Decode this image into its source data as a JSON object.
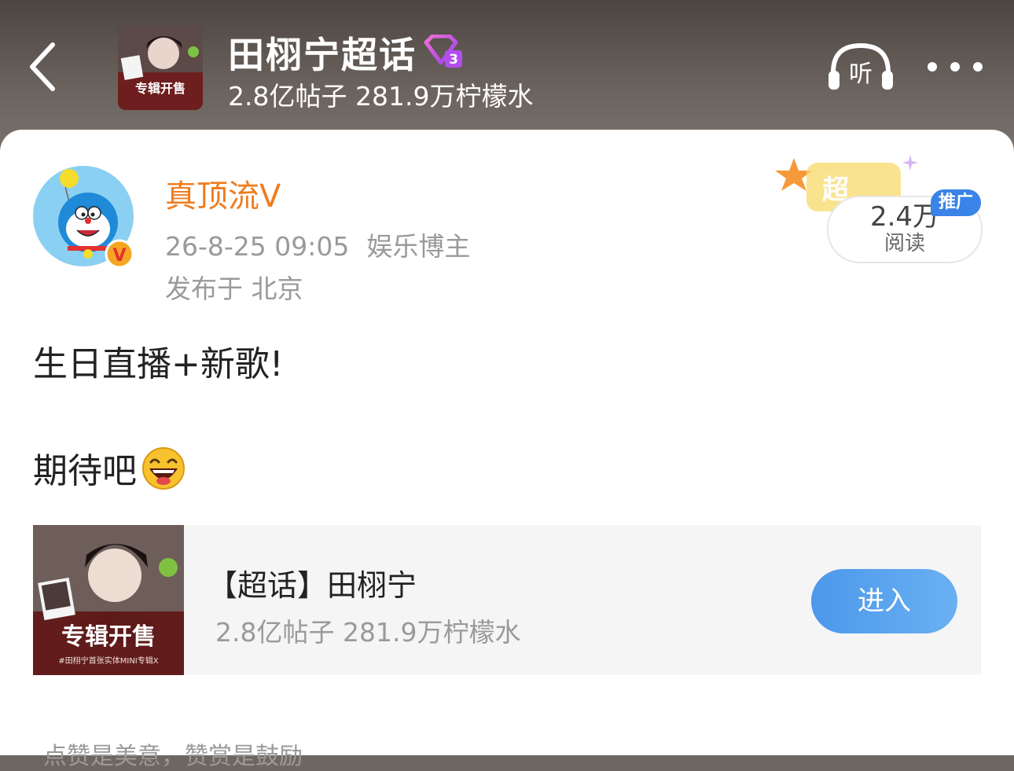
{
  "header": {
    "title": "田栩宁超话",
    "level_badge": "3",
    "stats": "2.8亿帖子 281.9万柠檬水",
    "listen_label": "听",
    "cover_text": "专辑开售",
    "icons": [
      "chevron-left-icon",
      "headphones-icon",
      "more-icon",
      "diamond-level-icon"
    ]
  },
  "post": {
    "author": "真顶流Ⅴ",
    "verified_badge": "V",
    "timestamp": "26-8-25 09:05",
    "author_tag": "娱乐博主",
    "location": "发布于 北京",
    "read_count": "2.4万",
    "read_label": "阅读",
    "promo_tag": "推广",
    "promo_bg_text": "超",
    "content_line1": "生日直播+新歌!",
    "content_line2": "期待吧",
    "emoji": "laughing-face-emoji"
  },
  "topic_card": {
    "title": "【超话】田栩宁",
    "stats": "2.8亿帖子 281.9万柠檬水",
    "enter_label": "进入",
    "cover_text": "专辑开售",
    "cover_subtext": "#田栩宁首张实体MINI专辑X"
  },
  "footer": {
    "hint": "点赞是美意，赞赏是鼓励"
  },
  "colors": {
    "accent_orange": "#f07c1e",
    "button_blue": "#4c98ea",
    "header_bg": "#5a524e"
  }
}
